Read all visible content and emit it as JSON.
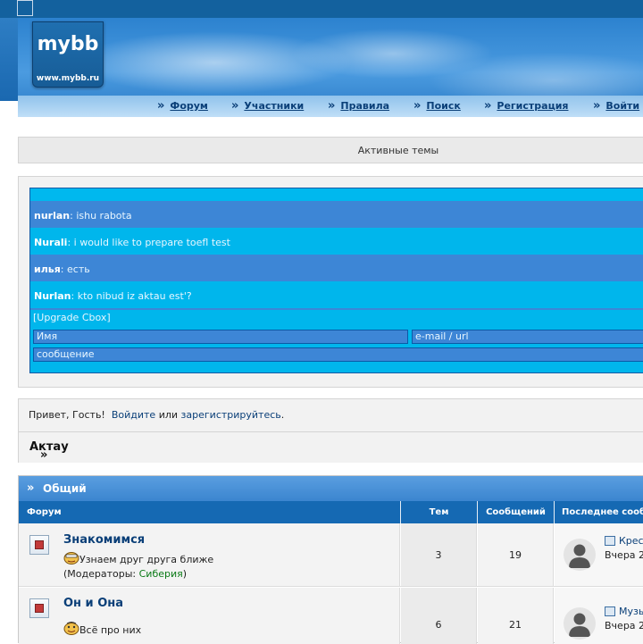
{
  "header": {
    "logo_text": "mybb",
    "logo_url": "www.mybb.ru",
    "nav": [
      {
        "label": "Форум"
      },
      {
        "label": "Участники"
      },
      {
        "label": "Правила"
      },
      {
        "label": "Поиск"
      },
      {
        "label": "Регистрация"
      },
      {
        "label": "Войти"
      }
    ]
  },
  "active_topics": {
    "label": "Активные темы"
  },
  "cbox": {
    "messages": [
      {
        "user": "nurlan",
        "text": ": ishu rabota"
      },
      {
        "user": "Nurali",
        "text": ": i would like to prepare toefl test"
      },
      {
        "user": "илья",
        "text": ": есть"
      },
      {
        "user": "Nurlan",
        "text": ": kto nibud iz aktau est'?"
      }
    ],
    "upgrade_link": "[Upgrade Cbox]",
    "name_placeholder": "Имя",
    "email_placeholder": "e-mail / url",
    "message_placeholder": "сообщение"
  },
  "welcome": {
    "greeting": "Привет, Гость!",
    "login": "Войдите",
    "or": "или",
    "register": "зарегистрируйтесь",
    "period": "."
  },
  "breadcrumb": {
    "prefix": "»",
    "label": "Актау"
  },
  "category": {
    "arrow": "»",
    "title": "Общий",
    "columns": {
      "forum": "Форум",
      "topics": "Тем",
      "posts": "Сообщений",
      "last": "Последнее сообщение"
    },
    "forums": [
      {
        "name": "Знакомимся",
        "description": "Узнаем друг друга ближе",
        "moderators_label": "(Модераторы: ",
        "moderator": "Сиберия",
        "moderators_close": ")",
        "topics": "3",
        "posts": "19",
        "last_title": "Крес",
        "last_date": "Вчера 2"
      },
      {
        "name": "Он и Она",
        "description": "Всё про них",
        "topics": "6",
        "posts": "21",
        "last_title": "Музы",
        "last_date": "Вчера 2"
      }
    ]
  },
  "colors": {
    "header_blue": "#13619e",
    "cbox_bg": "#00b8ee",
    "cbox_dark_row": "#3d86d6",
    "category_head": "#3b85cf",
    "column_head": "#1569b3",
    "link": "#0a3f78",
    "moderator_link": "#0a7a16"
  }
}
